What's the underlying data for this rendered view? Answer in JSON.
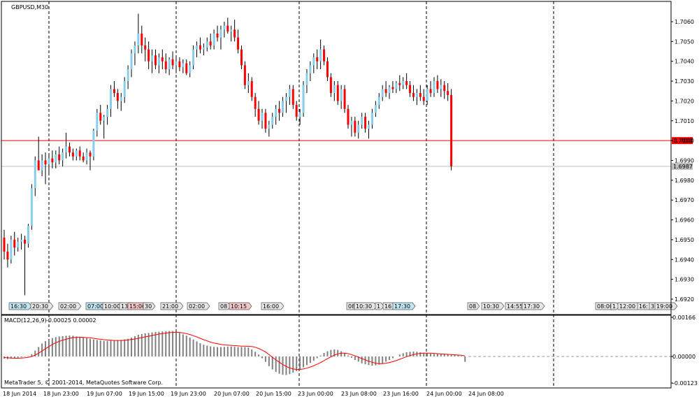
{
  "symbol_label": "GBPUSD,M30",
  "copyright": "MetaTrader 5, © 2001-2014, MetaQuotes Software Corp.",
  "colors": {
    "bull": "#87CEEB",
    "bear": "#FF0000",
    "wick": "#000000",
    "hline_red": "#FF0000",
    "hline_gray": "#C0C0C0",
    "macd_hist": "#808080",
    "macd_signal": "#FF0000",
    "event_blue": "#BFE6F2",
    "event_red": "#F5C6C6",
    "event_gray": "#E6E6E6"
  },
  "chart_data": {
    "type": "candlestick",
    "symbol": "GBPUSD",
    "timeframe": "M30",
    "ylim": [
      1.6915,
      1.7068
    ],
    "y_ticks": [
      "1.7060",
      "1.7050",
      "1.7040",
      "1.7030",
      "1.7020",
      "1.7010",
      "1.7000",
      "1.6990",
      "1.6980",
      "1.6970",
      "1.6960",
      "1.6950",
      "1.6940",
      "1.6930",
      "1.6920"
    ],
    "x_labels": [
      "18 Jun 2014",
      "18 Jun 23:00",
      "19 Jun 07:00",
      "19 Jun 15:00",
      "19 Jun 23:00",
      "20 Jun 07:00",
      "20 Jun 15:00",
      "23 Jun 00:00",
      "23 Jun 08:00",
      "23 Jun 16:00",
      "24 Jun 00:00",
      "24 Jun 08:00"
    ],
    "day_separators": [
      "18 Jun 2014",
      "19 Jun 2014",
      "20 Jun 2014",
      "23 Jun 2014",
      "24 Jun 2014",
      "25 Jun 2014"
    ],
    "hlines": [
      {
        "price": 1.7,
        "label": "1.7000",
        "color": "red"
      },
      {
        "price": 1.6987,
        "label": "1.6987",
        "color": "gray"
      }
    ],
    "candles_ohlc": [
      [
        1.6951,
        1.6955,
        1.694,
        1.6944
      ],
      [
        1.6944,
        1.6948,
        1.6936,
        1.694
      ],
      [
        1.694,
        1.6952,
        1.6938,
        1.695
      ],
      [
        1.695,
        1.6954,
        1.6942,
        1.6946
      ],
      [
        1.6946,
        1.6951,
        1.6944,
        1.6949
      ],
      [
        1.6949,
        1.6953,
        1.6945,
        1.695
      ],
      [
        1.695,
        1.6952,
        1.6922,
        1.6948
      ],
      [
        1.6948,
        1.6958,
        1.6946,
        1.6957
      ],
      [
        1.6957,
        1.6978,
        1.6955,
        1.6976
      ],
      [
        1.6976,
        1.6992,
        1.6972,
        1.699
      ],
      [
        1.699,
        1.7002,
        1.6986,
        1.6985
      ],
      [
        1.6985,
        1.6993,
        1.6982,
        1.699
      ],
      [
        1.699,
        1.6994,
        1.6978,
        1.6988
      ],
      [
        1.6988,
        1.6993,
        1.6983,
        1.6991
      ],
      [
        1.6991,
        1.6995,
        1.6986,
        1.6989
      ],
      [
        1.6989,
        1.6995,
        1.6986,
        1.6993
      ],
      [
        1.6993,
        1.6997,
        1.6988,
        1.699
      ],
      [
        1.699,
        1.6996,
        1.6987,
        1.6994
      ],
      [
        1.6994,
        1.7004,
        1.6991,
        1.6997
      ],
      [
        1.6997,
        1.6999,
        1.6992,
        1.6994
      ],
      [
        1.6994,
        1.6996,
        1.699,
        1.6992
      ],
      [
        1.6992,
        1.6996,
        1.699,
        1.6995
      ],
      [
        1.6995,
        1.6997,
        1.699,
        1.6992
      ],
      [
        1.6992,
        1.6994,
        1.6989,
        1.699
      ],
      [
        1.699,
        1.6996,
        1.6988,
        1.6994
      ],
      [
        1.6994,
        1.6995,
        1.6985,
        1.6992
      ],
      [
        1.6992,
        1.7006,
        1.699,
        1.7005
      ],
      [
        1.7005,
        1.7016,
        1.7002,
        1.7014
      ],
      [
        1.7014,
        1.7018,
        1.7008,
        1.701
      ],
      [
        1.701,
        1.7013,
        1.7001,
        1.7012
      ],
      [
        1.7012,
        1.7018,
        1.7008,
        1.7016
      ],
      [
        1.7016,
        1.7028,
        1.7012,
        1.7026
      ],
      [
        1.7026,
        1.703,
        1.7022,
        1.7024
      ],
      [
        1.7024,
        1.7026,
        1.7016,
        1.702
      ],
      [
        1.702,
        1.7024,
        1.7015,
        1.7022
      ],
      [
        1.7022,
        1.7032,
        1.7019,
        1.703
      ],
      [
        1.703,
        1.7038,
        1.7026,
        1.7036
      ],
      [
        1.7036,
        1.7046,
        1.7032,
        1.7044
      ],
      [
        1.7044,
        1.705,
        1.7038,
        1.7048
      ],
      [
        1.7048,
        1.7064,
        1.7044,
        1.7054
      ],
      [
        1.7054,
        1.7058,
        1.7044,
        1.7048
      ],
      [
        1.7048,
        1.7052,
        1.704,
        1.7046
      ],
      [
        1.7046,
        1.705,
        1.7036,
        1.704
      ],
      [
        1.704,
        1.7046,
        1.7034,
        1.7043
      ],
      [
        1.7043,
        1.7046,
        1.7036,
        1.7038
      ],
      [
        1.7038,
        1.7044,
        1.7034,
        1.7042
      ],
      [
        1.7042,
        1.7046,
        1.7036,
        1.704
      ],
      [
        1.704,
        1.7044,
        1.7034,
        1.7036
      ],
      [
        1.7036,
        1.7042,
        1.7033,
        1.7041
      ],
      [
        1.7041,
        1.7045,
        1.7036,
        1.7038
      ],
      [
        1.7038,
        1.7042,
        1.7034,
        1.704
      ],
      [
        1.704,
        1.7042,
        1.7035,
        1.7037
      ],
      [
        1.7037,
        1.7041,
        1.7034,
        1.7039
      ],
      [
        1.7039,
        1.7041,
        1.7033,
        1.7034
      ],
      [
        1.7034,
        1.704,
        1.7032,
        1.7038
      ],
      [
        1.7038,
        1.7048,
        1.7036,
        1.7046
      ],
      [
        1.7046,
        1.705,
        1.7042,
        1.7048
      ],
      [
        1.7048,
        1.7052,
        1.7044,
        1.7046
      ],
      [
        1.7046,
        1.7049,
        1.7043,
        1.7047
      ],
      [
        1.7047,
        1.7052,
        1.7045,
        1.705
      ],
      [
        1.705,
        1.7054,
        1.7046,
        1.7048
      ],
      [
        1.7048,
        1.7056,
        1.7046,
        1.7054
      ],
      [
        1.7054,
        1.7058,
        1.705,
        1.7052
      ],
      [
        1.7052,
        1.7058,
        1.7046,
        1.7056
      ],
      [
        1.7056,
        1.706,
        1.7052,
        1.7058
      ],
      [
        1.7058,
        1.7062,
        1.7054,
        1.7055
      ],
      [
        1.7055,
        1.7058,
        1.705,
        1.7056
      ],
      [
        1.7056,
        1.7061,
        1.705,
        1.7052
      ],
      [
        1.7052,
        1.7056,
        1.7044,
        1.7046
      ],
      [
        1.7046,
        1.7048,
        1.7036,
        1.7038
      ],
      [
        1.7038,
        1.704,
        1.7026,
        1.7028
      ],
      [
        1.7028,
        1.7034,
        1.7024,
        1.703
      ],
      [
        1.703,
        1.7032,
        1.702,
        1.7022
      ],
      [
        1.7022,
        1.7024,
        1.7012,
        1.7016
      ],
      [
        1.7016,
        1.702,
        1.7008,
        1.701
      ],
      [
        1.701,
        1.7016,
        1.7006,
        1.7014
      ],
      [
        1.7014,
        1.7016,
        1.7004,
        1.7006
      ],
      [
        1.7006,
        1.701,
        1.7002,
        1.7008
      ],
      [
        1.7008,
        1.7014,
        1.7006,
        1.7012
      ],
      [
        1.7012,
        1.7018,
        1.7008,
        1.7016
      ],
      [
        1.7016,
        1.702,
        1.701,
        1.7014
      ],
      [
        1.7014,
        1.7022,
        1.7012,
        1.702
      ],
      [
        1.702,
        1.7024,
        1.7014,
        1.7022
      ],
      [
        1.7022,
        1.7028,
        1.7018,
        1.7026
      ],
      [
        1.7026,
        1.7028,
        1.7016,
        1.7018
      ],
      [
        1.7018,
        1.702,
        1.701,
        1.7012
      ],
      [
        1.7012,
        1.7016,
        1.7008,
        1.7014
      ],
      [
        1.7014,
        1.703,
        1.7012,
        1.7028
      ],
      [
        1.7028,
        1.7036,
        1.7024,
        1.7034
      ],
      [
        1.7034,
        1.704,
        1.703,
        1.7038
      ],
      [
        1.7038,
        1.7044,
        1.7034,
        1.7042
      ],
      [
        1.7042,
        1.7046,
        1.7036,
        1.704
      ],
      [
        1.704,
        1.7051,
        1.7036,
        1.7046
      ],
      [
        1.7046,
        1.7048,
        1.7038,
        1.704
      ],
      [
        1.704,
        1.7042,
        1.703,
        1.7032
      ],
      [
        1.7032,
        1.7034,
        1.7022,
        1.7024
      ],
      [
        1.7024,
        1.703,
        1.702,
        1.7028
      ],
      [
        1.7028,
        1.703,
        1.7018,
        1.702
      ],
      [
        1.702,
        1.7028,
        1.7016,
        1.7026
      ],
      [
        1.7026,
        1.7028,
        1.7014,
        1.7016
      ],
      [
        1.7016,
        1.7018,
        1.7006,
        1.7008
      ],
      [
        1.7008,
        1.7012,
        1.7002,
        1.701
      ],
      [
        1.701,
        1.7012,
        1.7002,
        1.7004
      ],
      [
        1.7004,
        1.701,
        1.7001,
        1.7008
      ],
      [
        1.7008,
        1.7014,
        1.7006,
        1.7012
      ],
      [
        1.7012,
        1.7014,
        1.7004,
        1.7006
      ],
      [
        1.7006,
        1.701,
        1.7001,
        1.7008
      ],
      [
        1.7008,
        1.7016,
        1.7006,
        1.7014
      ],
      [
        1.7014,
        1.702,
        1.7012,
        1.7018
      ],
      [
        1.7018,
        1.7024,
        1.7016,
        1.7022
      ],
      [
        1.7022,
        1.7028,
        1.702,
        1.7026
      ],
      [
        1.7026,
        1.703,
        1.7022,
        1.7024
      ],
      [
        1.7024,
        1.7028,
        1.7021,
        1.7027
      ],
      [
        1.7027,
        1.703,
        1.7024,
        1.7026
      ],
      [
        1.7026,
        1.703,
        1.7024,
        1.7029
      ],
      [
        1.7029,
        1.7033,
        1.7025,
        1.7028
      ],
      [
        1.7028,
        1.7032,
        1.7026,
        1.703
      ],
      [
        1.703,
        1.7034,
        1.7026,
        1.7028
      ],
      [
        1.7028,
        1.703,
        1.7022,
        1.7024
      ],
      [
        1.7024,
        1.7028,
        1.702,
        1.7022
      ],
      [
        1.7022,
        1.7026,
        1.7018,
        1.7024
      ],
      [
        1.7024,
        1.7028,
        1.702,
        1.7022
      ],
      [
        1.7022,
        1.7026,
        1.7018,
        1.702
      ],
      [
        1.702,
        1.7028,
        1.7018,
        1.7026
      ],
      [
        1.7026,
        1.703,
        1.7022,
        1.7024
      ],
      [
        1.7024,
        1.7032,
        1.7022,
        1.703
      ],
      [
        1.703,
        1.7033,
        1.7024,
        1.7026
      ],
      [
        1.7026,
        1.7031,
        1.7022,
        1.7028
      ],
      [
        1.7028,
        1.703,
        1.7021,
        1.7025
      ],
      [
        1.7025,
        1.7029,
        1.702,
        1.7023
      ],
      [
        1.7023,
        1.7026,
        1.6985,
        1.6987
      ]
    ],
    "macd": {
      "name": "MACD(12,26,9)",
      "values_label": "-0.00025 0.00002",
      "ylim": [
        -0.00123,
        0.00166
      ],
      "y_ticks": [
        "0.00166",
        "0.00000",
        "-0.00123"
      ],
      "histogram": [
        -0.0001,
        -0.00012,
        -0.0001,
        -8e-05,
        -6e-05,
        -4e-05,
        -2e-05,
        2e-05,
        0.0001,
        0.00025,
        0.0004,
        0.00055,
        0.00065,
        0.00072,
        0.00078,
        0.00082,
        0.00085,
        0.00086,
        0.00088,
        0.00089,
        0.00088,
        0.00085,
        0.00082,
        0.0008,
        0.00078,
        0.00075,
        0.00072,
        0.0007,
        0.00068,
        0.00066,
        0.00066,
        0.00067,
        0.00068,
        0.00069,
        0.0007,
        0.00072,
        0.00075,
        0.0008,
        0.00086,
        0.00092,
        0.00095,
        0.00098,
        0.001,
        0.00102,
        0.00104,
        0.00105,
        0.00106,
        0.00107,
        0.00108,
        0.00108,
        0.00105,
        0.001,
        0.00094,
        0.00088,
        0.0008,
        0.00072,
        0.00064,
        0.00056,
        0.0005,
        0.00046,
        0.00043,
        0.00041,
        0.0004,
        0.0004,
        0.00041,
        0.00042,
        0.00042,
        0.00041,
        0.0004,
        0.0004,
        0.0004,
        0.00038,
        0.0003,
        0.0002,
        8e-05,
        -8e-05,
        -0.00025,
        -0.00045,
        -0.0006,
        -0.00072,
        -0.0008,
        -0.00085,
        -0.00086,
        -0.00082,
        -0.00075,
        -0.00068,
        -0.0006,
        -0.0005,
        -0.0004,
        -0.0003,
        -0.0002,
        -8e-05,
        4e-05,
        0.00015,
        0.00022,
        0.00028,
        0.0003,
        0.00028,
        0.00022,
        0.00014,
        4e-05,
        -6e-05,
        -0.00016,
        -0.00024,
        -0.00032,
        -0.00036,
        -0.0004,
        -0.00042,
        -0.00041,
        -0.00038,
        -0.00032,
        -0.00024,
        -0.00016,
        -8e-05,
        0.0,
        8e-05,
        0.00014,
        0.00018,
        0.0002,
        0.00021,
        0.0002,
        0.00018,
        0.00016,
        0.00014,
        0.00012,
        0.0001,
        0.0001,
        0.0001,
        0.0001,
        9e-05,
        8e-05,
        6e-05,
        4e-05,
        2e-05,
        -0.00025
      ],
      "signal": [
        -5e-05,
        -6e-05,
        -7e-05,
        -8e-05,
        -8e-05,
        -7e-05,
        -6e-05,
        -4e-05,
        0.0,
        6e-05,
        0.00014,
        0.00023,
        0.00033,
        0.00042,
        0.00051,
        0.00058,
        0.00064,
        0.00069,
        0.00073,
        0.00077,
        0.0008,
        0.00081,
        0.00082,
        0.00081,
        0.0008,
        0.00079,
        0.00077,
        0.00075,
        0.00073,
        0.00071,
        0.0007,
        0.00069,
        0.00068,
        0.00068,
        0.00068,
        0.00069,
        0.0007,
        0.00072,
        0.00074,
        0.00077,
        0.0008,
        0.00083,
        0.00086,
        0.00089,
        0.00092,
        0.00095,
        0.00097,
        0.00099,
        0.00101,
        0.00102,
        0.00103,
        0.00102,
        0.001,
        0.00097,
        0.00093,
        0.00088,
        0.00083,
        0.00077,
        0.00071,
        0.00066,
        0.00061,
        0.00057,
        0.00054,
        0.00051,
        0.00049,
        0.00048,
        0.00047,
        0.00046,
        0.00045,
        0.00044,
        0.00044,
        0.00043,
        0.00042,
        0.00039,
        0.00034,
        0.00027,
        0.00019,
        8e-05,
        -4e-05,
        -0.00016,
        -0.00027,
        -0.00037,
        -0.00046,
        -0.00053,
        -0.00058,
        -0.0006,
        -0.0006,
        -0.00058,
        -0.00054,
        -0.00049,
        -0.00043,
        -0.00036,
        -0.00028,
        -0.00019,
        -0.0001,
        -2e-05,
        6e-05,
        0.00011,
        0.00014,
        0.00014,
        0.00012,
        8e-05,
        3e-05,
        -3e-05,
        -0.0001,
        -0.00016,
        -0.00022,
        -0.00027,
        -0.00031,
        -0.00033,
        -0.00033,
        -0.00031,
        -0.00028,
        -0.00024,
        -0.00019,
        -0.00013,
        -7e-05,
        -1e-05,
        4e-05,
        8e-05,
        0.00011,
        0.00013,
        0.00014,
        0.00014,
        0.00014,
        0.00013,
        0.00012,
        0.00011,
        0.0001,
        9e-05,
        8e-05,
        7e-05,
        6e-05,
        5e-05,
        2e-05
      ]
    },
    "events": [
      {
        "label": "16:30",
        "color": "blue"
      },
      {
        "label": "20:30",
        "color": "gray"
      },
      {
        "label": "02:00",
        "color": "gray"
      },
      {
        "label": "07:00",
        "color": "blue"
      },
      {
        "label": "10:00",
        "color": "gray"
      },
      {
        "label": "13:",
        "color": "gray"
      },
      {
        "label": "15:00",
        "color": "red"
      },
      {
        "label": "30",
        "color": "gray"
      },
      {
        "label": "21:00",
        "color": "gray"
      },
      {
        "label": "02:00",
        "color": "gray"
      },
      {
        "label": "08",
        "color": "gray"
      },
      {
        "label": "10:15",
        "color": "red"
      },
      {
        "label": "16:00",
        "color": "gray"
      },
      {
        "label": "08",
        "color": "gray"
      },
      {
        "label": "10:30",
        "color": "gray"
      },
      {
        "label": "1",
        "color": "gray"
      },
      {
        "label": "16",
        "color": "gray"
      },
      {
        "label": "17:30",
        "color": "blue"
      },
      {
        "label": "08",
        "color": "gray"
      },
      {
        "label": "10:30",
        "color": "gray"
      },
      {
        "label": "14:55",
        "color": "gray"
      },
      {
        "label": "17:30",
        "color": "gray"
      },
      {
        "label": "08:00",
        "color": "gray"
      },
      {
        "label": "1",
        "color": "gray"
      },
      {
        "label": "12:00",
        "color": "gray"
      },
      {
        "label": "16:",
        "color": "gray"
      },
      {
        "label": "3",
        "color": "gray"
      },
      {
        "label": "19:00",
        "color": "gray"
      }
    ]
  }
}
